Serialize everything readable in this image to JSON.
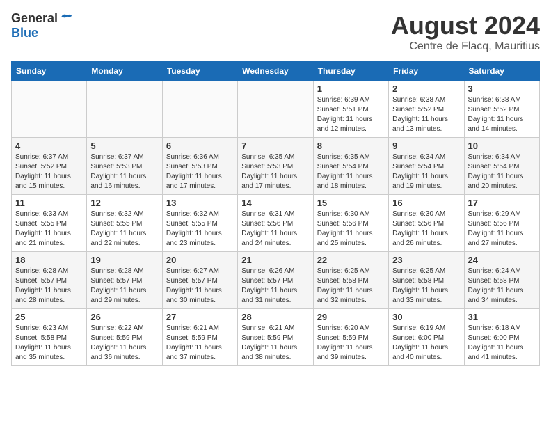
{
  "header": {
    "logo_general": "General",
    "logo_blue": "Blue",
    "month_year": "August 2024",
    "location": "Centre de Flacq, Mauritius"
  },
  "weekdays": [
    "Sunday",
    "Monday",
    "Tuesday",
    "Wednesday",
    "Thursday",
    "Friday",
    "Saturday"
  ],
  "weeks": [
    [
      {
        "day": "",
        "info": ""
      },
      {
        "day": "",
        "info": ""
      },
      {
        "day": "",
        "info": ""
      },
      {
        "day": "",
        "info": ""
      },
      {
        "day": "1",
        "info": "Sunrise: 6:39 AM\nSunset: 5:51 PM\nDaylight: 11 hours\nand 12 minutes."
      },
      {
        "day": "2",
        "info": "Sunrise: 6:38 AM\nSunset: 5:52 PM\nDaylight: 11 hours\nand 13 minutes."
      },
      {
        "day": "3",
        "info": "Sunrise: 6:38 AM\nSunset: 5:52 PM\nDaylight: 11 hours\nand 14 minutes."
      }
    ],
    [
      {
        "day": "4",
        "info": "Sunrise: 6:37 AM\nSunset: 5:52 PM\nDaylight: 11 hours\nand 15 minutes."
      },
      {
        "day": "5",
        "info": "Sunrise: 6:37 AM\nSunset: 5:53 PM\nDaylight: 11 hours\nand 16 minutes."
      },
      {
        "day": "6",
        "info": "Sunrise: 6:36 AM\nSunset: 5:53 PM\nDaylight: 11 hours\nand 17 minutes."
      },
      {
        "day": "7",
        "info": "Sunrise: 6:35 AM\nSunset: 5:53 PM\nDaylight: 11 hours\nand 17 minutes."
      },
      {
        "day": "8",
        "info": "Sunrise: 6:35 AM\nSunset: 5:54 PM\nDaylight: 11 hours\nand 18 minutes."
      },
      {
        "day": "9",
        "info": "Sunrise: 6:34 AM\nSunset: 5:54 PM\nDaylight: 11 hours\nand 19 minutes."
      },
      {
        "day": "10",
        "info": "Sunrise: 6:34 AM\nSunset: 5:54 PM\nDaylight: 11 hours\nand 20 minutes."
      }
    ],
    [
      {
        "day": "11",
        "info": "Sunrise: 6:33 AM\nSunset: 5:55 PM\nDaylight: 11 hours\nand 21 minutes."
      },
      {
        "day": "12",
        "info": "Sunrise: 6:32 AM\nSunset: 5:55 PM\nDaylight: 11 hours\nand 22 minutes."
      },
      {
        "day": "13",
        "info": "Sunrise: 6:32 AM\nSunset: 5:55 PM\nDaylight: 11 hours\nand 23 minutes."
      },
      {
        "day": "14",
        "info": "Sunrise: 6:31 AM\nSunset: 5:56 PM\nDaylight: 11 hours\nand 24 minutes."
      },
      {
        "day": "15",
        "info": "Sunrise: 6:30 AM\nSunset: 5:56 PM\nDaylight: 11 hours\nand 25 minutes."
      },
      {
        "day": "16",
        "info": "Sunrise: 6:30 AM\nSunset: 5:56 PM\nDaylight: 11 hours\nand 26 minutes."
      },
      {
        "day": "17",
        "info": "Sunrise: 6:29 AM\nSunset: 5:56 PM\nDaylight: 11 hours\nand 27 minutes."
      }
    ],
    [
      {
        "day": "18",
        "info": "Sunrise: 6:28 AM\nSunset: 5:57 PM\nDaylight: 11 hours\nand 28 minutes."
      },
      {
        "day": "19",
        "info": "Sunrise: 6:28 AM\nSunset: 5:57 PM\nDaylight: 11 hours\nand 29 minutes."
      },
      {
        "day": "20",
        "info": "Sunrise: 6:27 AM\nSunset: 5:57 PM\nDaylight: 11 hours\nand 30 minutes."
      },
      {
        "day": "21",
        "info": "Sunrise: 6:26 AM\nSunset: 5:57 PM\nDaylight: 11 hours\nand 31 minutes."
      },
      {
        "day": "22",
        "info": "Sunrise: 6:25 AM\nSunset: 5:58 PM\nDaylight: 11 hours\nand 32 minutes."
      },
      {
        "day": "23",
        "info": "Sunrise: 6:25 AM\nSunset: 5:58 PM\nDaylight: 11 hours\nand 33 minutes."
      },
      {
        "day": "24",
        "info": "Sunrise: 6:24 AM\nSunset: 5:58 PM\nDaylight: 11 hours\nand 34 minutes."
      }
    ],
    [
      {
        "day": "25",
        "info": "Sunrise: 6:23 AM\nSunset: 5:58 PM\nDaylight: 11 hours\nand 35 minutes."
      },
      {
        "day": "26",
        "info": "Sunrise: 6:22 AM\nSunset: 5:59 PM\nDaylight: 11 hours\nand 36 minutes."
      },
      {
        "day": "27",
        "info": "Sunrise: 6:21 AM\nSunset: 5:59 PM\nDaylight: 11 hours\nand 37 minutes."
      },
      {
        "day": "28",
        "info": "Sunrise: 6:21 AM\nSunset: 5:59 PM\nDaylight: 11 hours\nand 38 minutes."
      },
      {
        "day": "29",
        "info": "Sunrise: 6:20 AM\nSunset: 5:59 PM\nDaylight: 11 hours\nand 39 minutes."
      },
      {
        "day": "30",
        "info": "Sunrise: 6:19 AM\nSunset: 6:00 PM\nDaylight: 11 hours\nand 40 minutes."
      },
      {
        "day": "31",
        "info": "Sunrise: 6:18 AM\nSunset: 6:00 PM\nDaylight: 11 hours\nand 41 minutes."
      }
    ]
  ]
}
